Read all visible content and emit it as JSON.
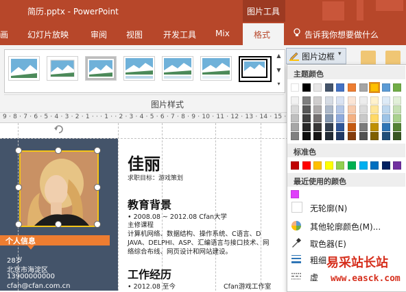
{
  "window": {
    "title": "简历.pptx  -  PowerPoint",
    "context_tab_group": "图片工具"
  },
  "tabs": [
    "画",
    "幻灯片放映",
    "审阅",
    "视图",
    "开发工具",
    "Mix"
  ],
  "active_tab": "格式",
  "tell_me": "告诉我你想要做什么",
  "ribbon": {
    "group_label": "图片样式",
    "picture_border_button": "图片边框"
  },
  "ruler": "9 · 8 · 7 · 6 · 5 · 4 · 3 · 2 · 1 · · · 1 · · 2 · 3 · 4 · 5 · 6 · 7 · 8 · 9 · 10 · 11 · 12 · 13 · 14 · 15 · 16 · 1",
  "slide": {
    "name": "佳丽",
    "job_title": "求职目标：游戏策划",
    "personal_info_label": "个人信息",
    "personal": [
      "28岁",
      "北京市海淀区",
      "13900000000",
      "cfan@cfan.com.cn"
    ],
    "education_heading": "教育背景",
    "education_lines": [
      "•  2008.08 ~ 2012.08 Cfan大学",
      "主修课程",
      "计算机网络、数据结构、操作系统、C语言、D",
      "JAVA、DELPHI、ASP、汇编语言与接口技术、网",
      "络综合布线、网页设计和网站建设。"
    ],
    "work_heading": "工作经历",
    "work_lines": [
      "•  2012.08 至今",
      "Cfan游戏工作室"
    ]
  },
  "dropdown": {
    "theme_colors_label": "主题颜色",
    "standard_colors_label": "标准色",
    "recent_colors_label": "最近使用的颜色",
    "no_outline": "无轮廓(N)",
    "more_colors": "其他轮廓颜色(M)...",
    "eyedropper": "取色器(E)",
    "weight": "粗细",
    "dashes": "虚"
  },
  "colors": {
    "theme_top": [
      "#ffffff",
      "#000000",
      "#e7e6e6",
      "#44546a",
      "#4472c4",
      "#ed7d31",
      "#a5a5a5",
      "#ffc000",
      "#5b9bd5",
      "#70ad47"
    ],
    "theme_shades": [
      [
        "#f2f2f2",
        "#7f7f7f",
        "#d0cece",
        "#d6dce5",
        "#dae3f3",
        "#fbe5d6",
        "#ededed",
        "#fff2cc",
        "#deebf7",
        "#e2f0d9"
      ],
      [
        "#d9d9d9",
        "#595959",
        "#aeabab",
        "#adb9ca",
        "#b4c7e7",
        "#f8cbad",
        "#dbdbdb",
        "#ffe699",
        "#bdd7ee",
        "#c5e0b4"
      ],
      [
        "#bfbfbf",
        "#404040",
        "#757171",
        "#8497b0",
        "#8faadc",
        "#f4b183",
        "#c9c9c9",
        "#ffd966",
        "#9dc3e6",
        "#a9d18e"
      ],
      [
        "#a6a6a6",
        "#262626",
        "#3a3838",
        "#333f50",
        "#2f5597",
        "#c55a11",
        "#7b7b7b",
        "#bf9000",
        "#2e75b6",
        "#548235"
      ],
      [
        "#808080",
        "#0d0d0d",
        "#171616",
        "#222a35",
        "#203864",
        "#843c0c",
        "#525252",
        "#7f6000",
        "#1f4e79",
        "#385723"
      ]
    ],
    "standard": [
      "#c00000",
      "#ff0000",
      "#ffc000",
      "#ffff00",
      "#92d050",
      "#00b050",
      "#00b0f0",
      "#0070c0",
      "#002060",
      "#7030a0"
    ],
    "recent": [
      "#e040fb"
    ],
    "accent": "#b7472a",
    "selected_swatch": "#ffc000"
  },
  "watermark": {
    "line1": "易采站长站",
    "line2": "www.easck.com"
  }
}
